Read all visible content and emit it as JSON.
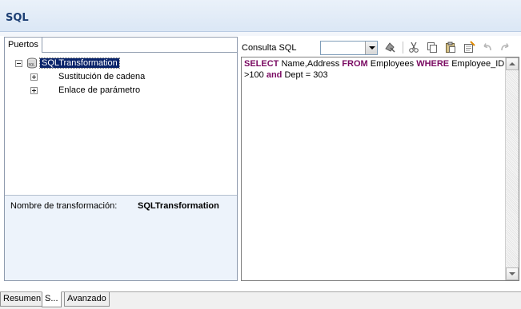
{
  "header": {
    "title": "SQL"
  },
  "left_panel": {
    "tab_label": "Puertos",
    "tree": {
      "root": {
        "label": "SQLTransformation",
        "icon": "database-icon",
        "expanded": true,
        "selected": true
      },
      "children": [
        {
          "label": "Sustitución de cadena",
          "expanded": false
        },
        {
          "label": "Enlace de parámetro",
          "expanded": false
        }
      ]
    },
    "footer": {
      "name_label": "Nombre de transformación:",
      "name_value": "SQLTransformation"
    }
  },
  "right_panel": {
    "sql_label": "Consulta SQL",
    "combo_value": "",
    "toolbar": [
      "validate-icon",
      "cut-icon",
      "copy-icon",
      "paste-icon",
      "format-icon",
      "undo-icon",
      "redo-icon"
    ],
    "query": {
      "line1": {
        "kw1": "SELECT",
        "t1": " Name,Address ",
        "kw2": "FROM",
        "t2": " Employees ",
        "kw3": "WHERE",
        "t3": " Employee_ID"
      },
      "line2": {
        "t1": ">100 ",
        "kw1": "and",
        "t2": " Dept = 303"
      }
    },
    "keyword_color": "#7a0a62"
  },
  "bottom_tabs": [
    {
      "label": "Resumen",
      "active": false
    },
    {
      "label": "S...",
      "active": true
    },
    {
      "label": "Avanzado",
      "active": false
    }
  ],
  "colors": {
    "title_text": "#1d3f74",
    "title_band": "#dbe7f5",
    "selection": "#0a246a",
    "footer_bg": "#edf3fb"
  }
}
